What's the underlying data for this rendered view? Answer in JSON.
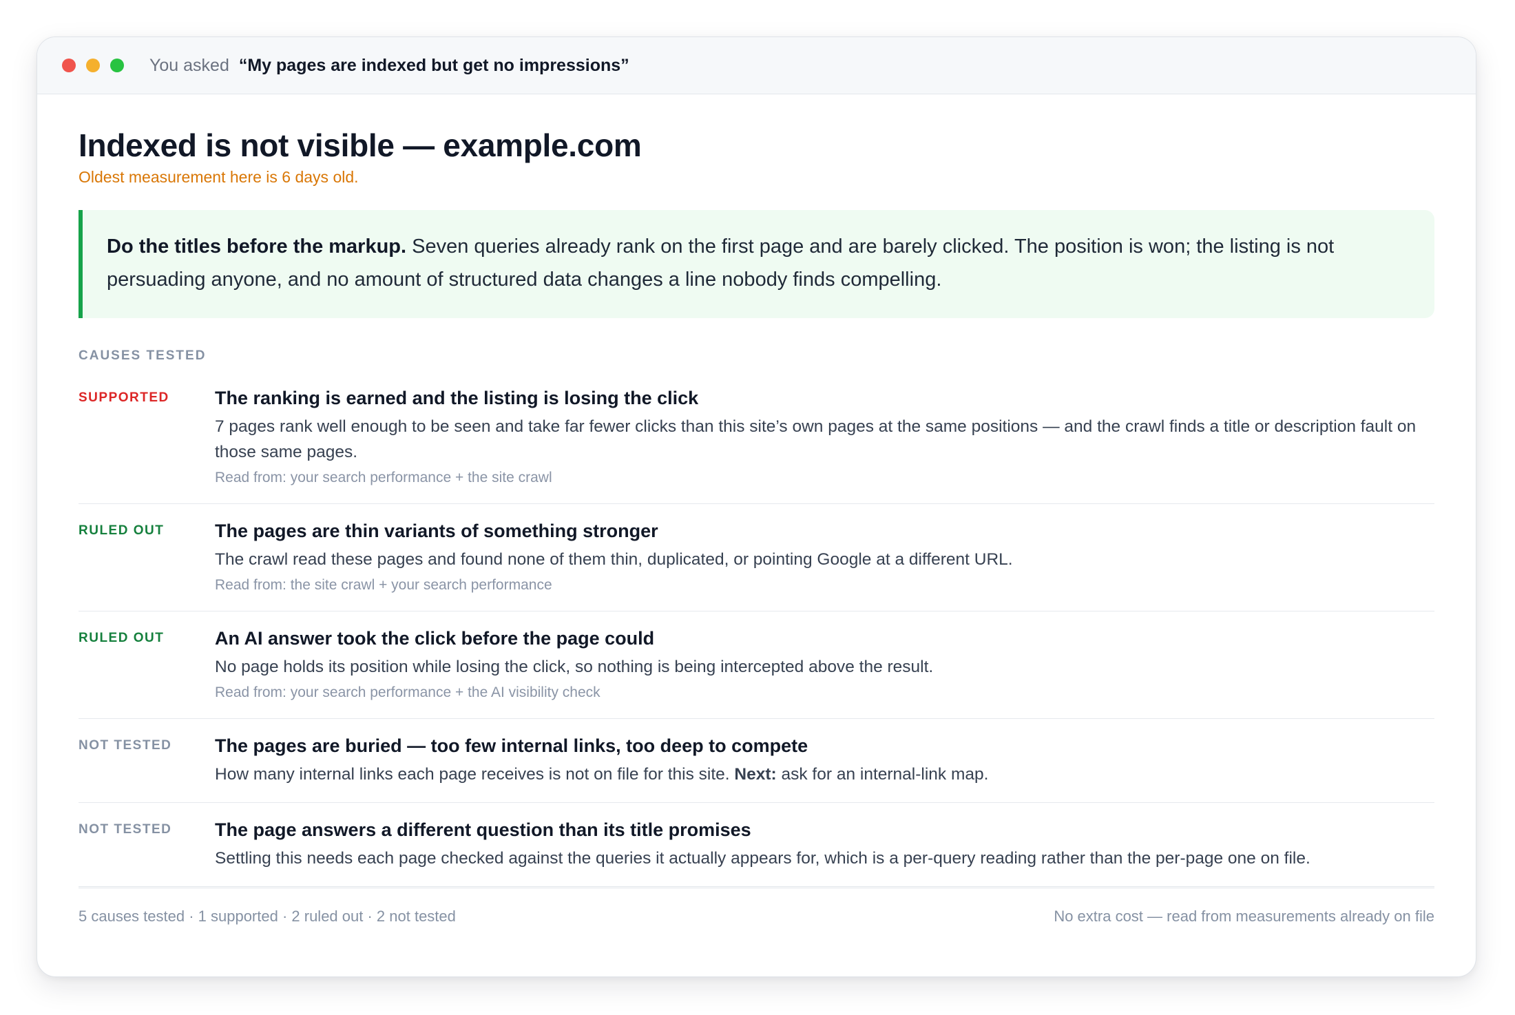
{
  "titlebar": {
    "asked_label": "You asked",
    "query": "“My pages are indexed but get no impressions”"
  },
  "header": {
    "title": "Indexed is not visible — example.com",
    "freshness": "Oldest measurement here is 6 days old."
  },
  "verdict": {
    "lead": "Do the titles before the markup.",
    "body": " Seven queries already rank on the first page and are barely clicked. The position is won; the listing is not persuading anyone, and no amount of structured data changes a line nobody finds compelling."
  },
  "section_label": "CAUSES TESTED",
  "causes": [
    {
      "status": "SUPPORTED",
      "title": "The ranking is earned and the listing is losing the click",
      "desc": "7 pages rank well enough to be seen and take far fewer clicks than this site’s own pages at the same positions — and the crawl finds a title or description fault on those same pages.",
      "source": "Read from: your search performance + the site crawl"
    },
    {
      "status": "RULED OUT",
      "title": "The pages are thin variants of something stronger",
      "desc": "The crawl read these pages and found none of them thin, duplicated, or pointing Google at a different URL.",
      "source": "Read from: the site crawl + your search performance"
    },
    {
      "status": "RULED OUT",
      "title": "An AI answer took the click before the page could",
      "desc": "No page holds its position while losing the click, so nothing is being intercepted above the result.",
      "source": "Read from: your search performance + the AI visibility check"
    },
    {
      "status": "NOT TESTED",
      "title": "The pages are buried — too few internal links, too deep to compete",
      "desc": "How many internal links each page receives is not on file for this site. ",
      "next_label": "Next:",
      "next_text": " ask for an internal-link map."
    },
    {
      "status": "NOT TESTED",
      "title": "The page answers a different question than its title promises",
      "desc": "Settling this needs each page checked against the queries it actually appears for, which is a per-query reading rather than the per-page one on file."
    }
  ],
  "footer": {
    "summary": "5 causes tested · 1 supported · 2 ruled out · 2 not tested",
    "cost_note": "No extra cost — read from measurements already on file"
  },
  "colors": {
    "supported": "#dc2626",
    "ruled_out": "#15803d",
    "not_tested": "#8591a3",
    "freshness": "#d97706",
    "verdict_accent": "#16a34a",
    "verdict_bg": "#effbf2"
  }
}
